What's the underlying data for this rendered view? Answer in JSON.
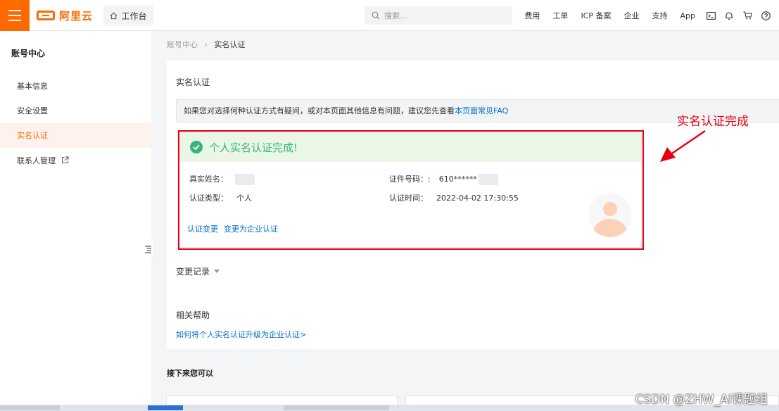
{
  "topbar": {
    "logo_text": "阿里云",
    "workbench": "工作台",
    "search_placeholder": "搜索...",
    "nav": [
      "费用",
      "工单",
      "ICP 备案",
      "企业",
      "支持",
      "App"
    ]
  },
  "sidebar": {
    "title": "账号中心",
    "items": [
      {
        "label": "基本信息"
      },
      {
        "label": "安全设置"
      },
      {
        "label": "实名认证"
      },
      {
        "label": "联系人管理"
      }
    ]
  },
  "breadcrumb": {
    "parent": "账号中心",
    "sep": "›",
    "current": "实名认证"
  },
  "panel": {
    "title": "实名认证",
    "notice_text": "如果您对选择何种认证方式有疑问，或对本页面其他信息有问题，建议您先查看",
    "notice_link": "本页面常见FAQ",
    "status": "个人实名认证完成!",
    "fields": {
      "name_label": "真实姓名：",
      "type_label": "认证类型：",
      "type_value": "个人",
      "id_label": "证件号码：:",
      "id_value": "610******",
      "time_label": "认证时间：",
      "time_value": "2022-04-02 17:30:55"
    },
    "links": [
      "认证变更",
      "变更为企业认证"
    ],
    "change_log": "变更记录",
    "help_title": "相关帮助",
    "help_link": "如何将个人实名认证升级为企业认证>"
  },
  "next_title": "接下来您可以",
  "annotation": "实名认证完成",
  "watermark": "CSDN @ZHW_AI课题组",
  "colors": {
    "brand": "#ff6a00",
    "success": "#36b37e",
    "link": "#0070cc",
    "annotation": "#e60012"
  }
}
